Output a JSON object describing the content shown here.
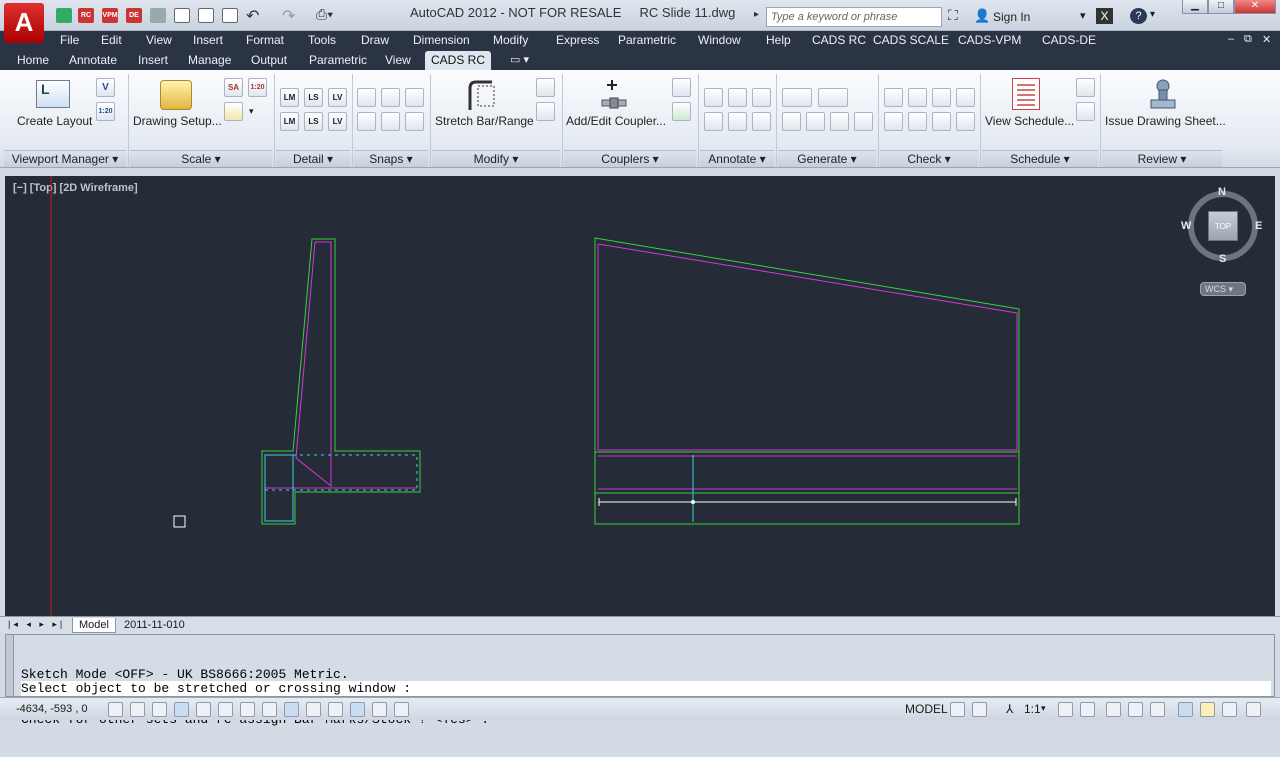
{
  "titlebar": {
    "title": "AutoCAD 2012 - NOT FOR RESALE     RC Slide 11.dwg",
    "search_placeholder": "Type a keyword or phrase",
    "sign_in": "Sign In",
    "quick_access": [
      "RC",
      "VPM",
      "DE"
    ]
  },
  "menubar": {
    "items": [
      "File",
      "Edit",
      "View",
      "Insert",
      "Format",
      "Tools",
      "Draw",
      "Dimension",
      "Modify",
      "Express",
      "Parametric",
      "Window",
      "Help",
      "CADS RC",
      "CADS SCALE",
      "CADS-VPM",
      "CADS-DE"
    ]
  },
  "ribbon_tabs": {
    "items": [
      "Home",
      "Annotate",
      "Insert",
      "Manage",
      "Output",
      "Parametric",
      "View",
      "CADS RC"
    ],
    "active": "CADS RC"
  },
  "ribbon": {
    "create_layout": "Create Layout",
    "drawing_setup": "Drawing Setup...",
    "stretch_bar": "Stretch Bar/Range",
    "add_coupler": "Add/Edit Coupler...",
    "view_schedule": "View Schedule...",
    "issue_drawing": "Issue Drawing Sheet...",
    "panels": {
      "viewport_manager": "Viewport Manager",
      "scale": "Scale",
      "detail": "Detail",
      "snaps": "Snaps",
      "modify": "Modify",
      "couplers": "Couplers",
      "annotate": "Annotate",
      "generate": "Generate",
      "check": "Check",
      "schedule": "Schedule",
      "review": "Review"
    },
    "small_labels": {
      "v": "V",
      "scale_1_20": "1:20",
      "sa": "SA",
      "scale_1_20b": "1:20",
      "lm": "LM",
      "ls": "LS",
      "lv": "LV",
      "lm2": "LM",
      "ls2": "LS",
      "lv2": "LV"
    }
  },
  "viewport": {
    "label": "[−] [Top] [2D Wireframe]",
    "compass": {
      "n": "N",
      "s": "S",
      "e": "E",
      "w": "W",
      "top": "TOP",
      "wcs": "WCS"
    }
  },
  "layout_tabs": {
    "model": "Model",
    "layout1": "2011-11-010"
  },
  "command": {
    "history": [
      "Sketch Mode <OFF> - UK BS8666:2005 Metric.",
      "Check for other sets and re-assign Bar Marks/Stock ? <Yes> :"
    ],
    "prompt": "Select object to be stretched or crossing window :"
  },
  "statusbar": {
    "coords": "-4634, -593 , 0",
    "model": "MODEL",
    "scale": "1:1"
  },
  "colors": {
    "canvas": "#252b37",
    "green_outline": "#39d23a",
    "magenta_bar": "#d13ad6",
    "cyan_bar": "#3fd0e0",
    "red_axis": "#c81e1e"
  }
}
